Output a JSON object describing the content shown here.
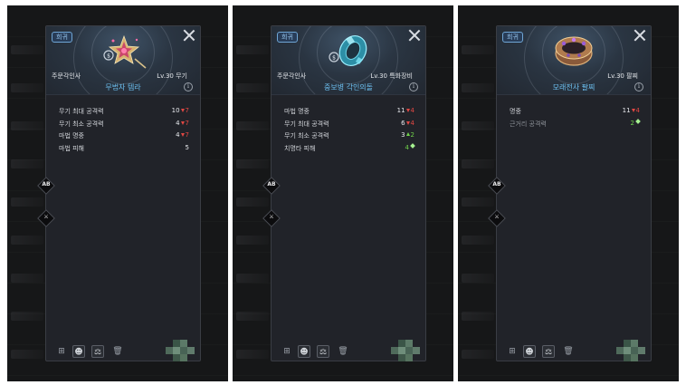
{
  "colors": {
    "grade_text": "#9ccdf6",
    "item_name": "#6ec2f3",
    "decrease": "#e14843",
    "increase": "#6fd14a",
    "card_bg": "#212329"
  },
  "panels": [
    {
      "grade": "희귀",
      "title_left": "주문각인사",
      "title_right": "Lv.30 무기",
      "item_name": "무법자 템라",
      "item_icon": "star-wand-icon",
      "stats": [
        {
          "label": "무기 최대 공격력",
          "value": "10",
          "change": "7",
          "change_dir": "down"
        },
        {
          "label": "무기 최소 공격력",
          "value": "4",
          "change": "7",
          "change_dir": "down"
        },
        {
          "label": "마법 명중",
          "value": "4",
          "change": "7",
          "change_dir": "down"
        },
        {
          "label": "마법 피해",
          "value": "5",
          "change": "",
          "change_dir": "none"
        }
      ]
    },
    {
      "grade": "희귀",
      "title_left": "주문각인사",
      "title_right": "Lv.30 특화장비",
      "item_name": "중보병 각인의돌",
      "item_icon": "crystal-ring-icon",
      "stats": [
        {
          "label": "마법 명중",
          "value": "11",
          "change": "4",
          "change_dir": "down"
        },
        {
          "label": "무기 최대 공격력",
          "value": "6",
          "change": "4",
          "change_dir": "down"
        },
        {
          "label": "무기 최소 공격력",
          "value": "3",
          "change": "2",
          "change_dir": "up"
        },
        {
          "label": "치명타 피해",
          "value": "4",
          "change": "",
          "change_dir": "new"
        }
      ]
    },
    {
      "grade": "희귀",
      "title_left": "",
      "title_right": "Lv.30 팔찌",
      "item_name": "모래전사 팔찌",
      "item_icon": "bracelet-icon",
      "stats": [
        {
          "label": "명중",
          "value": "11",
          "change": "4",
          "change_dir": "down"
        },
        {
          "label": "근거리 공격력",
          "value": "2",
          "change": "",
          "change_dir": "new",
          "dim": true
        }
      ]
    }
  ],
  "side_buttons": [
    {
      "label": "AB",
      "icon": "compare-ab-icon"
    },
    {
      "label": "",
      "icon": "character-swap-icon"
    }
  ],
  "bottom_icons": [
    "equip-icon",
    "head-icon",
    "scale-icon",
    "trash-icon"
  ],
  "head_icon_count": "1"
}
